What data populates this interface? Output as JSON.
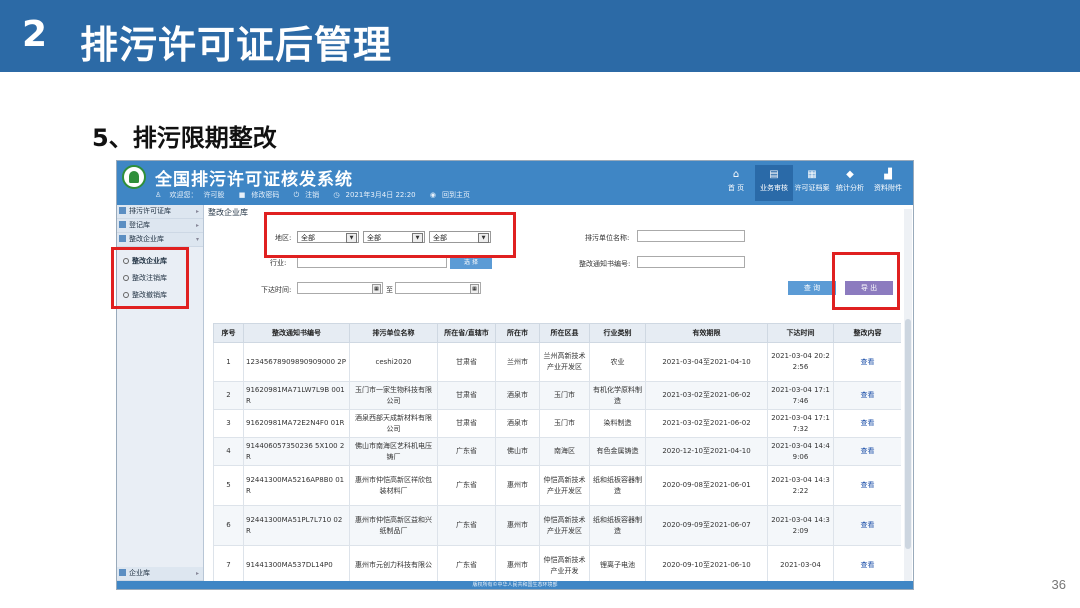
{
  "slide": {
    "number": "2",
    "title": "排污许可证后管理",
    "section": "5、排污限期整改",
    "page": "36"
  },
  "app": {
    "title": "全国排污许可证核发系统",
    "info": {
      "welcome": "欢迎您：",
      "user": "许可股",
      "change_password": "修改密码",
      "logout": "注销",
      "datetime": "2021年3月4日 22:20",
      "home": "回到主页"
    },
    "nav": [
      {
        "icon": "home-icon",
        "glyph": "⌂",
        "label": "首 页"
      },
      {
        "icon": "business-icon",
        "glyph": "▤",
        "label": "业务审核"
      },
      {
        "icon": "permit-library-icon",
        "glyph": "▦",
        "label": "许可证档案"
      },
      {
        "icon": "statistics-icon",
        "glyph": "◆",
        "label": "统计分析"
      },
      {
        "icon": "data-icon",
        "glyph": "▟",
        "label": "资料附件"
      }
    ],
    "sidebar": {
      "top_items": [
        "排污许可证库",
        "登记库",
        "整改企业库"
      ],
      "sub_items": [
        "整改企业库",
        "整改注销库",
        "整改撤销库"
      ],
      "bottom_item": "企业库"
    },
    "breadcrumb": "整改企业库",
    "filters": {
      "region_label": "地区:",
      "province": "全部",
      "city": "全部",
      "county": "全部",
      "industry_label": "行业:",
      "unit_name_label": "排污单位名称:",
      "notice_no_label": "整改通知书编号:",
      "issue_time_label": "下达时间:",
      "to_label": "至"
    },
    "buttons": {
      "hidden": "选 择",
      "query": "查 询",
      "export": "导 出"
    },
    "table": {
      "headers": [
        "序号",
        "整改通知书编号",
        "排污单位名称",
        "所在省/直辖市",
        "所在市",
        "所在区县",
        "行业类别",
        "有效期限",
        "下达时间",
        "整改内容"
      ],
      "rows": [
        [
          "1",
          "12345678909890909000 2P",
          "ceshi2020",
          "甘肃省",
          "兰州市",
          "兰州高新技术产业开发区",
          "农业",
          "2021-03-04至2021-04-10",
          "2021-03-04 20:22:56",
          "查看"
        ],
        [
          "2",
          "91620981MA71LW7L9B 001R",
          "玉门市一家生物科技有限公司",
          "甘肃省",
          "酒泉市",
          "玉门市",
          "有机化学原料制造",
          "2021-03-02至2021-06-02",
          "2021-03-04 17:17:46",
          "查看"
        ],
        [
          "3",
          "91620981MA72E2N4F0 01R",
          "酒泉西部天成新材料有限公司",
          "甘肃省",
          "酒泉市",
          "玉门市",
          "染料制造",
          "2021-03-02至2021-06-02",
          "2021-03-04 17:17:32",
          "查看"
        ],
        [
          "4",
          "914406057350236 5X100 2R",
          "佛山市南海区艺科机电压铸厂",
          "广东省",
          "佛山市",
          "南海区",
          "有色金属铸造",
          "2020-12-10至2021-04-10",
          "2021-03-04 14:49:06",
          "查看"
        ],
        [
          "5",
          "92441300MA5216AP8B0 01R",
          "惠州市仲恺高新区祥欣包装材料厂",
          "广东省",
          "惠州市",
          "仲恺高新技术产业开发区",
          "纸和纸板容器制造",
          "2020-09-08至2021-06-01",
          "2021-03-04 14:32:22",
          "查看"
        ],
        [
          "6",
          "92441300MA51PL7L710 02R",
          "惠州市仲恺高新区益和兴纸制品厂",
          "广东省",
          "惠州市",
          "仲恺高新技术产业开发区",
          "纸和纸板容器制造",
          "2020-09-09至2021-06-07",
          "2021-03-04 14:32:09",
          "查看"
        ],
        [
          "7",
          "91441300MA537DL14P0",
          "惠州市元创力科技有限公",
          "广东省",
          "惠州市",
          "仲恺高新技术产业开发",
          "锂离子电池",
          "2020-09-10至2021-06-10",
          "2021-03-04",
          "查看"
        ]
      ]
    },
    "footer": "版权所有©中华人民共和国生态环境部"
  }
}
